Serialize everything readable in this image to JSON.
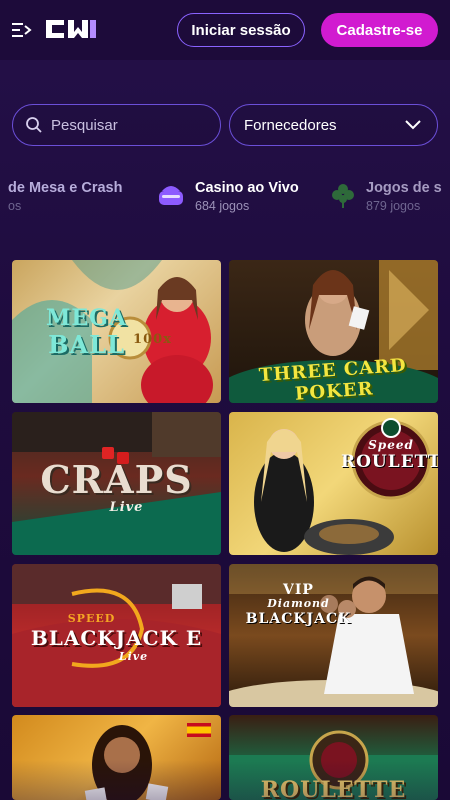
{
  "header": {
    "login_label": "Iniciar sessão",
    "signup_label": "Cadastre-se",
    "menu_icon": "menu-arrow-icon",
    "logo_icon": "cw-logo"
  },
  "filters": {
    "search_placeholder": "Pesquisar",
    "providers_label": "Fornecedores"
  },
  "categories": [
    {
      "name": "de Mesa e Crash",
      "count": "os",
      "icon": "table-games-icon"
    },
    {
      "name": "Casino ao Vivo",
      "count": "684 jogos",
      "icon": "live-casino-icon"
    },
    {
      "name": "Jogos de s",
      "count": "879 jogos",
      "icon": "clover-icon"
    }
  ],
  "games": [
    {
      "title_line1": "MEGA",
      "title_line2": "BALL",
      "badge": "100x"
    },
    {
      "title": "THREE CARD POKER"
    },
    {
      "title": "CRAPS",
      "subtitle": "Live"
    },
    {
      "title_line1": "Speed",
      "title_line2": "ROULETTE"
    },
    {
      "title_line1": "SPEED",
      "title_line2": "BLACKJACK E",
      "subtitle": "Live"
    },
    {
      "title_line1": "VIP",
      "title_line2": "Diamond",
      "title_line3": "BLACKJACK"
    },
    {
      "title": "",
      "flag": "spain-flag"
    },
    {
      "title": "ROULETTE"
    }
  ],
  "colors": {
    "brand_pink": "#d11bd0",
    "accent_purple": "#8a63ff",
    "background": "#1f0c3f"
  }
}
